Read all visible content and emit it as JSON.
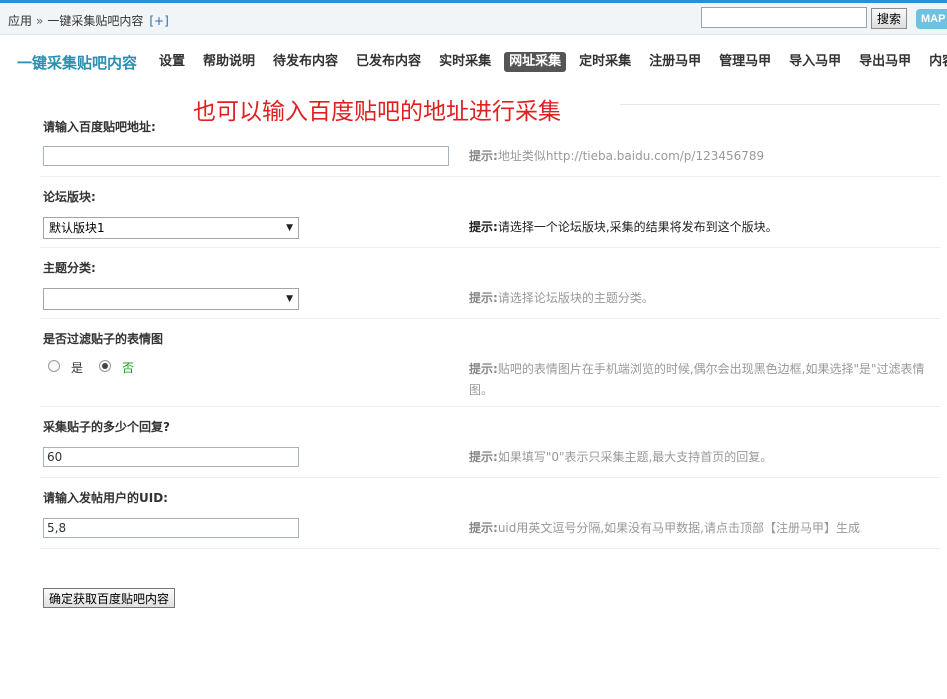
{
  "breadcrumb": {
    "root": "应用",
    "separator": "»",
    "current": "一键采集贴吧内容",
    "add": "[+]"
  },
  "search": {
    "value": "",
    "button_label": "搜索",
    "map_label": "MAP"
  },
  "header": {
    "brand": "一键采集贴吧内容",
    "nav": [
      "设置",
      "帮助说明",
      "待发布内容",
      "已发布内容",
      "实时采集",
      "网址采集",
      "定时采集",
      "注册马甲",
      "管理马甲",
      "导入马甲",
      "导出马甲",
      "内容回收站"
    ],
    "active_nav": "网址采集"
  },
  "annotation": "也可以输入百度贴吧的地址进行采集",
  "form": {
    "url": {
      "label": "请输入百度贴吧地址:",
      "value": "",
      "hint_prefix": "提示:",
      "hint": "地址类似http://tieba.baidu.com/p/123456789"
    },
    "forum": {
      "label": "论坛版块:",
      "selected": "默认版块1",
      "hint_prefix": "提示:",
      "hint": "请选择一个论坛版块,采集的结果将发布到这个版块。"
    },
    "category": {
      "label": "主题分类:",
      "selected": "",
      "hint_prefix": "提示:",
      "hint": "请选择论坛版块的主题分类。"
    },
    "filter_emoji": {
      "label": "是否过滤贴子的表情图",
      "option_yes": "是",
      "option_no": "否",
      "selected": "否",
      "hint_prefix": "提示:",
      "hint": "贴吧的表情图片在手机端浏览的时候,偶尔会出现黑色边框,如果选择\"是\"过滤表情图。"
    },
    "reply_count": {
      "label": "采集贴子的多少个回复?",
      "value": "60",
      "hint_prefix": "提示:",
      "hint": "如果填写\"0\"表示只采集主题,最大支持首页的回复。"
    },
    "uid": {
      "label": "请输入发帖用户的UID:",
      "value": "5,8",
      "hint_prefix": "提示:",
      "hint": "uid用英文逗号分隔,如果没有马甲数据,请点击顶部【注册马甲】生成"
    },
    "submit_label": "确定获取百度贴吧内容"
  }
}
